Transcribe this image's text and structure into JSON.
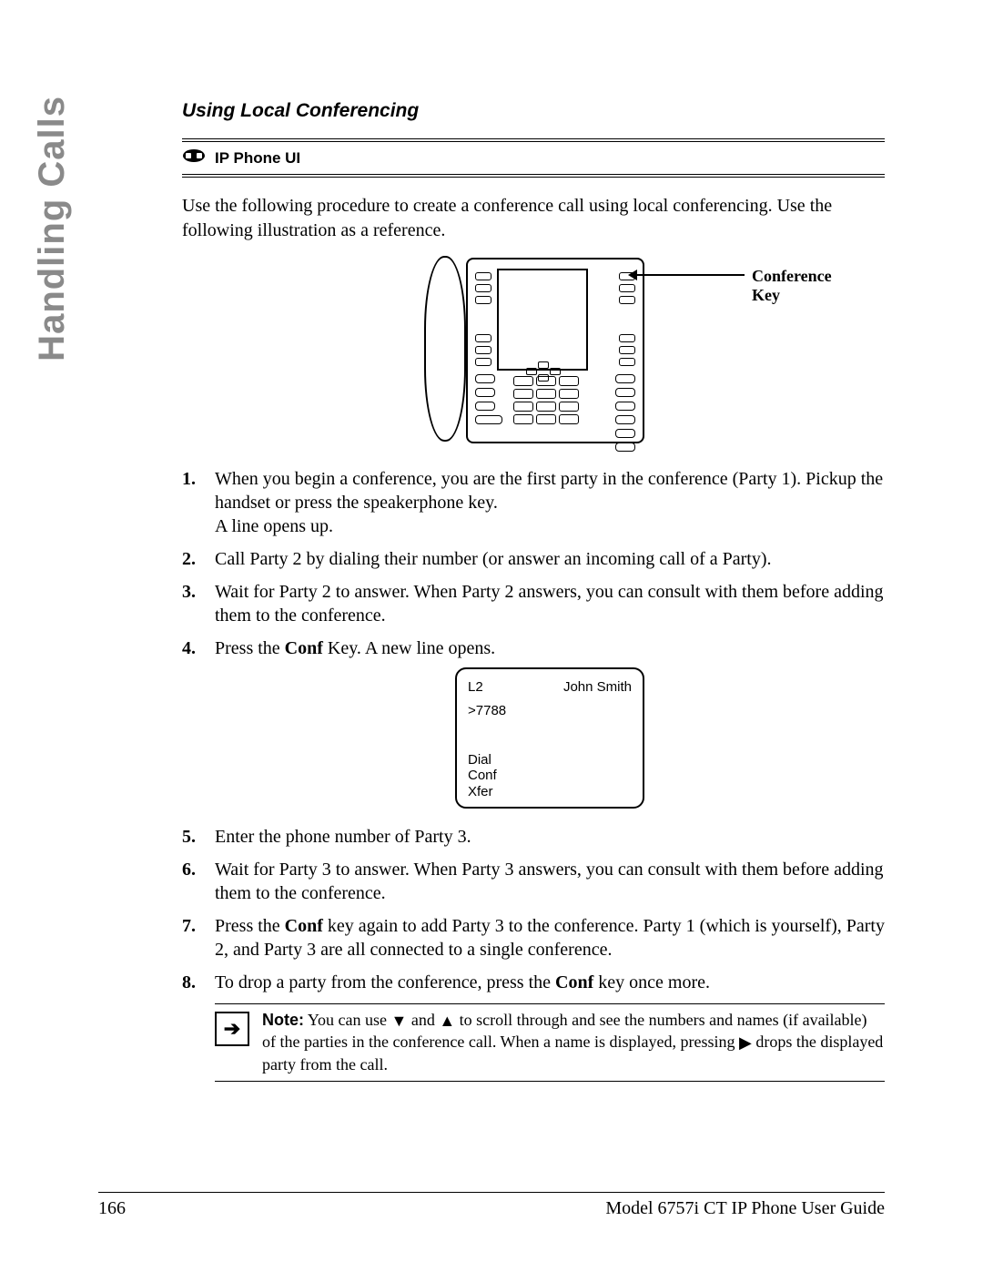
{
  "side_tab": "Handling Calls",
  "section_title": "Using Local Conferencing",
  "callout_label": "IP Phone UI",
  "intro": "Use the following procedure to create a conference call using local conferencing. Use the following illustration as a reference.",
  "phone_label": "Conference\nKey",
  "steps": {
    "s1": "When you begin a conference, you are the first party in the conference (Party 1). Pickup the handset or press the speakerphone key.\nA line opens up.",
    "s2": "Call Party 2 by dialing their number (or answer an incoming call of a Party).",
    "s3": "Wait for Party 2 to answer. When Party 2 answers, you can consult with them before adding them to the conference.",
    "s4_pre": "Press the ",
    "s4_bold": "Conf",
    "s4_post": " Key. A new line opens.",
    "s5": "Enter the phone number of Party 3.",
    "s6": "Wait for Party 3 to answer. When Party 3 answers, you can consult with them before adding them to the conference.",
    "s7_pre": "Press the ",
    "s7_bold": "Conf",
    "s7_post": " key again to add Party 3 to the conference. Party 1 (which is yourself), Party 2, and Party 3 are all connected to a single conference.",
    "s8_pre": "To drop a party from the conference, press the ",
    "s8_bold": "Conf",
    "s8_post": " key once more."
  },
  "lcd": {
    "line_label": "L2",
    "caller": "John Smith",
    "number": ">7788",
    "opt1": "Dial",
    "opt2": "Conf",
    "opt3": "Xfer"
  },
  "note": {
    "label": "Note:",
    "t1": " You can use ",
    "t2": " and ",
    "t3": " to scroll through and see the numbers and names (if available) of the parties in the conference call. When a name is displayed, pressing ",
    "t4": " drops the displayed party from the call."
  },
  "footer": {
    "page": "166",
    "title": "Model 6757i CT IP Phone User Guide"
  }
}
